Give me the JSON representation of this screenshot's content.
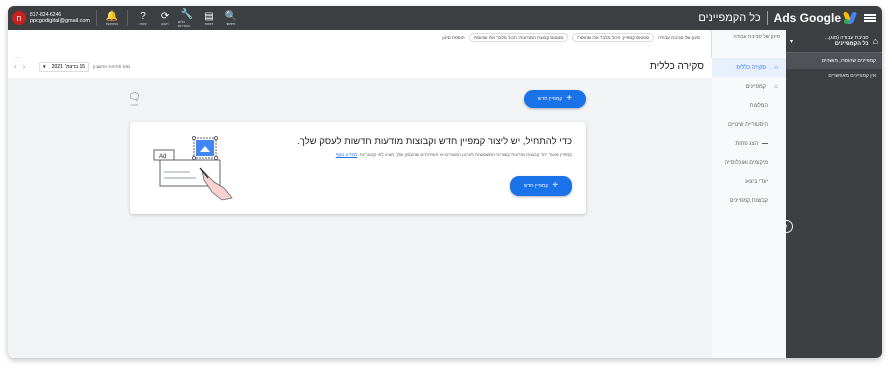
{
  "topbar": {
    "brand": "Ads Google",
    "page_title": "כל הקמפיינים",
    "account_phone": "817-824-6246",
    "account_email": "ppcgodigital@gmail.com",
    "avatar_letter": "ח",
    "icons": [
      {
        "name": "notifications-icon",
        "glyph": "🔔",
        "label": "התראות"
      },
      {
        "name": "help-icon",
        "glyph": "?",
        "label": "עזרה"
      },
      {
        "name": "refresh-icon",
        "glyph": "⟳",
        "label": "רענון"
      },
      {
        "name": "tools-icon",
        "glyph": "🔧",
        "label": "כלים והגדרות"
      },
      {
        "name": "reports-icon",
        "glyph": "▤",
        "label": "דוחות"
      },
      {
        "name": "search-icon",
        "glyph": "🔍",
        "label": "חיפוש"
      }
    ],
    "colors": {
      "bar": "#3c4043",
      "avatar": "#c5221f",
      "accent": "#1a73e8"
    }
  },
  "dark_sidebar": {
    "account_line1": "סביבת עבודה (מוגן...",
    "account_line2": "כל הקמפיינים",
    "items": [
      "קמפיינים שהוסרו, מושהים",
      "אין קמפיינים מאפשרים"
    ]
  },
  "filters": {
    "workspace": "סינון של סביבת עבודה",
    "chips": [
      "סטטוס קמפיין: הכול מלבד אלו שהוסרו",
      "סטטוס קבוצת המודעות: הכול מלבד אלו שהוסרו"
    ],
    "add_filter": "הוספת סינון"
  },
  "nav": {
    "items": [
      {
        "label": "סקירה כללית",
        "icon": "⌂",
        "active": true
      },
      {
        "label": "קמפיינים",
        "icon": "⌂",
        "active": false
      },
      {
        "label": "המלצות",
        "icon": "",
        "active": false
      },
      {
        "label": "היסטוריית שינויים",
        "icon": "",
        "active": false
      }
    ],
    "more_label": "הצג פחות",
    "sub_items": [
      "מיקומים ואוכלוסייה",
      "יעדי ביצוע",
      "קבוצות קמפיינים"
    ]
  },
  "header": {
    "title": "סקירה כללית",
    "date_label": "מאז פתיחת החשבון",
    "date_value": "15 בדצמ׳ 2021"
  },
  "main": {
    "new_campaign_label": "קמפיין חדש",
    "feedback_label": "משוב",
    "card": {
      "title": "כדי להתחיל, יש ליצור קמפיין חדש וקבוצות מודעות חדשות לעסק שלך.",
      "desc": "קמפיין מאגד יחד קבוצות מודעות קשורות המשמשות לארגון המוצרים או השירותים שהעסק שלך מציע לפי קטגוריות.",
      "link": "למידע נוסף",
      "button_label": "קמפיין חדש",
      "ad_tag": "Ad"
    }
  }
}
